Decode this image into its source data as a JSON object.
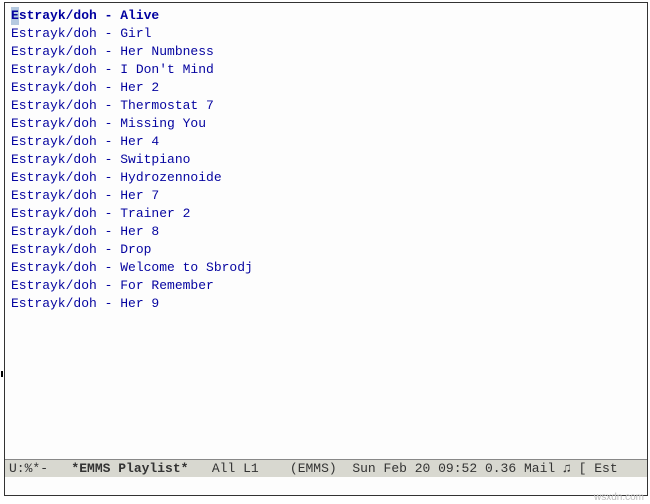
{
  "artist": "Estrayk/doh",
  "tracks": [
    {
      "title": "Alive",
      "current": true
    },
    {
      "title": "Girl",
      "current": false
    },
    {
      "title": "Her Numbness",
      "current": false
    },
    {
      "title": "I Don't Mind",
      "current": false
    },
    {
      "title": "Her 2",
      "current": false
    },
    {
      "title": "Thermostat 7",
      "current": false
    },
    {
      "title": "Missing You",
      "current": false
    },
    {
      "title": "Her 4",
      "current": false
    },
    {
      "title": "Switpiano",
      "current": false
    },
    {
      "title": "Hydrozennoide",
      "current": false
    },
    {
      "title": "Her 7",
      "current": false
    },
    {
      "title": "Trainer 2",
      "current": false
    },
    {
      "title": "Her 8",
      "current": false
    },
    {
      "title": "Drop",
      "current": false
    },
    {
      "title": "Welcome to Sbrodj",
      "current": false
    },
    {
      "title": "For Remember",
      "current": false
    },
    {
      "title": "Her 9",
      "current": false
    }
  ],
  "modeline": {
    "left_status": "U:%*-",
    "buffer_name": "*EMMS Playlist*",
    "position": "All L1",
    "mode": "(EMMS)",
    "datetime": "Sun Feb 20 09:52",
    "load": "0.36",
    "mail": "Mail",
    "music_icon": "♫",
    "tail": "[ Est"
  },
  "watermark": "wsxdn.com"
}
